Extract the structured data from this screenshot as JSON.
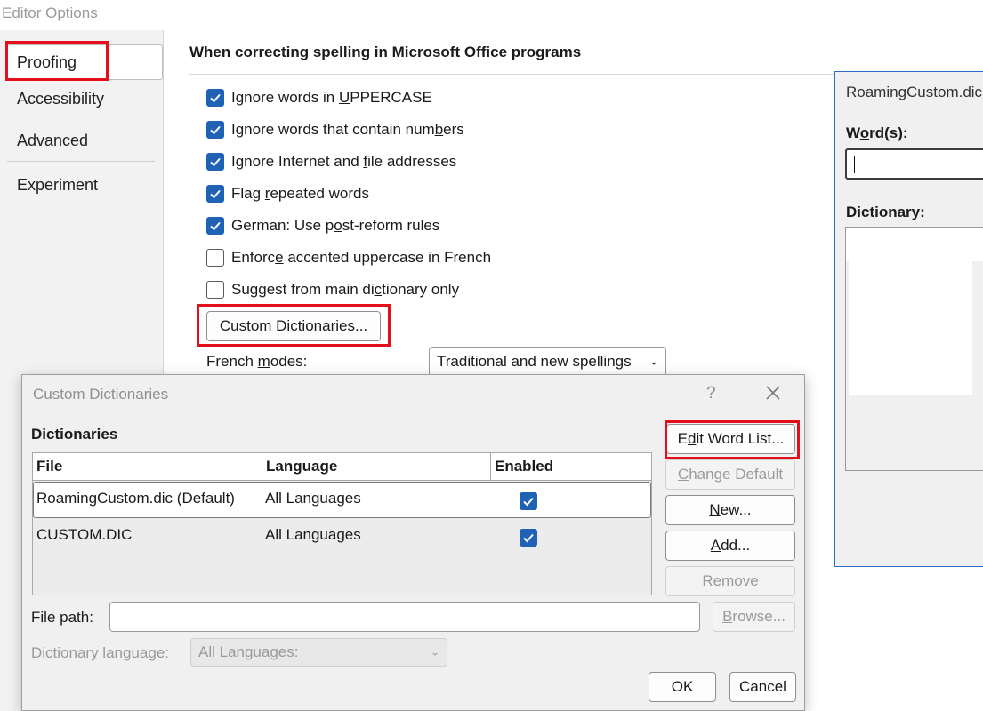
{
  "window": {
    "title": "Editor Options"
  },
  "sidebar": {
    "items": [
      {
        "label": "Proofing"
      },
      {
        "label": "Accessibility"
      },
      {
        "label": "Advanced"
      },
      {
        "label": "Experiment"
      }
    ]
  },
  "proofing": {
    "section_title": "When correcting spelling in Microsoft Office programs",
    "options": [
      {
        "before": "Ignore words in ",
        "accel": "U",
        "after": "PPERCASE",
        "checked": true
      },
      {
        "before": "Ignore words that contain num",
        "accel": "b",
        "after": "ers",
        "checked": true
      },
      {
        "before": "Ignore Internet and ",
        "accel": "f",
        "after": "ile addresses",
        "checked": true
      },
      {
        "before": "Flag ",
        "accel": "r",
        "after": "epeated words",
        "checked": true
      },
      {
        "before": "German: Use p",
        "accel": "o",
        "after": "st-reform rules",
        "checked": true
      },
      {
        "before": "Enforc",
        "accel": "e",
        "after": " accented uppercase in French",
        "checked": false
      },
      {
        "before": "Suggest from main di",
        "accel": "c",
        "after": "tionary only",
        "checked": false
      }
    ],
    "custom_dict_button": {
      "accel": "C",
      "rest": "ustom Dictionaries..."
    },
    "french_modes": {
      "before": "French ",
      "accel": "m",
      "after": "odes:",
      "value": "Traditional and new spellings"
    }
  },
  "custom_dictionaries": {
    "title": "Custom Dictionaries",
    "help": "?",
    "dictionaries_label": "Dictionaries",
    "columns": [
      "File",
      "Language",
      "Enabled"
    ],
    "rows": [
      {
        "file": "RoamingCustom.dic (Default)",
        "language": "All Languages",
        "enabled": true
      },
      {
        "file": "CUSTOM.DIC",
        "language": "All Languages",
        "enabled": true
      }
    ],
    "buttons": {
      "edit": {
        "before": "E",
        "accel": "d",
        "after": "it Word List..."
      },
      "change_default": {
        "accel": "C",
        "rest": "hange Default"
      },
      "new": {
        "accel": "N",
        "rest": "ew..."
      },
      "add": {
        "accel": "A",
        "rest": "dd..."
      },
      "remove": {
        "accel": "R",
        "rest": "emove"
      },
      "browse": {
        "accel": "B",
        "rest": "rowse..."
      },
      "ok": "OK",
      "cancel": "Cancel"
    },
    "file_path_label": "File path:",
    "file_path_value": "",
    "dict_language": {
      "before": "Dictionary lan",
      "accel": "g",
      "after": "uage:",
      "value": "All Languages:"
    }
  },
  "roaming_dialog": {
    "title": "RoamingCustom.dic",
    "words": {
      "before": "W",
      "accel": "o",
      "after": "rd(s):"
    },
    "dictionary_label": "Dictionary:"
  },
  "colors": {
    "accent": "#1f62b5",
    "highlight": "#e3101b"
  }
}
